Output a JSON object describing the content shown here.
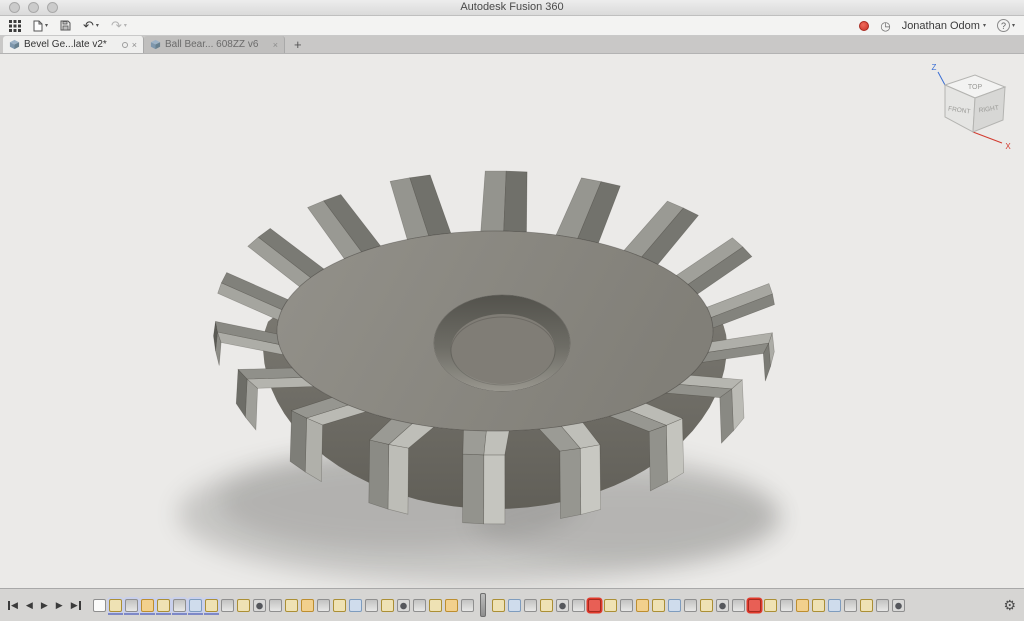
{
  "window": {
    "title": "Autodesk Fusion 360",
    "traffic_lights": [
      "close",
      "minimize",
      "zoom"
    ]
  },
  "toolbar": {
    "caret_glyph": "▾",
    "undo_glyph": "↶",
    "redo_glyph": "↷",
    "clock_glyph": "◷",
    "help_label": "?",
    "user_name": "Jonathan Odom"
  },
  "tabs": {
    "close_glyph": "×",
    "new_tab_glyph": "+",
    "items": [
      {
        "label": "Bevel Ge...late v2*",
        "active": true,
        "modified": true
      },
      {
        "label": "Ball Bear... 608ZZ v6",
        "active": false,
        "modified": false
      }
    ]
  },
  "viewcube": {
    "top": "TOP",
    "front": "FRONT",
    "right": "RIGHT",
    "axis_z": "Z",
    "axis_x": "X"
  },
  "playback": [
    {
      "name": "go-to-start-button",
      "glyph": "◀",
      "bar": "left"
    },
    {
      "name": "step-back-button",
      "glyph": "◀",
      "bar": "none"
    },
    {
      "name": "play-button",
      "glyph": "▶",
      "bar": "none"
    },
    {
      "name": "step-forward-button",
      "glyph": "▶",
      "bar": "none"
    },
    {
      "name": "go-to-end-button",
      "glyph": "▶",
      "bar": "right"
    }
  ],
  "timeline": {
    "settings_glyph": "⚙",
    "playhead_after": 23,
    "group_range": [
      1,
      7
    ],
    "legend": {
      "doc": "document-start-icon",
      "sketch": "sketch-feature-icon",
      "extrude": "extrude-feature-icon",
      "fillet": "fillet-feature-icon",
      "hole": "hole-feature-icon",
      "construct": "construction-geometry-icon",
      "flagged": "flagged-feature-icon"
    },
    "features": [
      "doc",
      "sketch",
      "extrude",
      "construct",
      "sketch",
      "extrude",
      "fillet",
      "sketch",
      "extrude",
      "sketch",
      "hole",
      "extrude",
      "sketch",
      "construct",
      "extrude",
      "sketch",
      "fillet",
      "extrude",
      "sketch",
      "hole",
      "extrude",
      "sketch",
      "construct",
      "extrude",
      "sketch",
      "fillet",
      "extrude",
      "sketch",
      "hole",
      "extrude",
      "flagged",
      "sketch",
      "extrude",
      "construct",
      "sketch",
      "fillet",
      "extrude",
      "sketch",
      "hole",
      "extrude",
      "flagged",
      "sketch",
      "extrude",
      "construct",
      "sketch",
      "fillet",
      "extrude",
      "sketch",
      "extrude",
      "hole"
    ]
  },
  "colors": {
    "accent_record": "#d7453a",
    "selection_red": "#e23a2c",
    "timeline_group_highlight": "#c9d0ec",
    "viewport_background": "#ebeae8",
    "axis_z_blue": "#3b6fd4",
    "axis_x_red": "#d23a2e"
  }
}
